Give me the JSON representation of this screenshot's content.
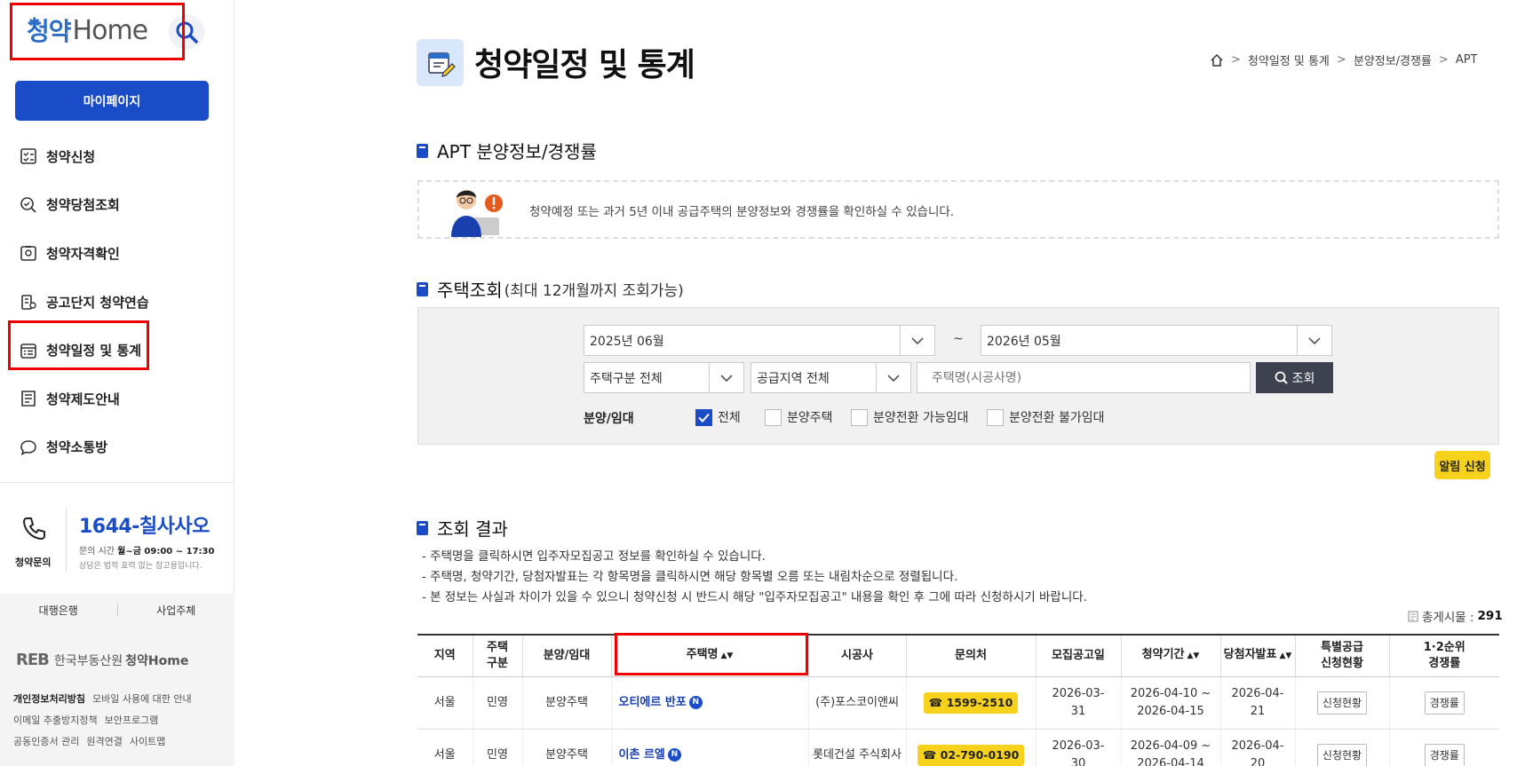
{
  "sidebar": {
    "logo_text_k": "청약",
    "logo_text_home": "Home",
    "mypage_label": "마이페이지",
    "nav": [
      {
        "label": "청약신청"
      },
      {
        "label": "청약당첨조회"
      },
      {
        "label": "청약자격확인"
      },
      {
        "label": "공고단지 청약연습"
      },
      {
        "label": "청약일정 및 통계"
      },
      {
        "label": "청약제도안내"
      },
      {
        "label": "청약소통방"
      }
    ],
    "contact": {
      "label": "청약문의",
      "number": "1644-칠사사오",
      "hours_prefix": "문의 시간 ",
      "hours_value": "월~금 09:00 ~ 17:30",
      "note": "상담은 법적 효력 없는 참고용입니다."
    },
    "tabs": [
      "대행은행",
      "사업주체"
    ],
    "org_mark": "REB",
    "org_name": "한국부동산원",
    "org_service": "청약Home",
    "links": [
      {
        "label": "개인정보처리방침",
        "bold": true
      },
      {
        "label": "모바일 사용에 대한 안내",
        "bold": false
      },
      {
        "label": "이메일 추출방지정책",
        "bold": false
      },
      {
        "label": "보안프로그램",
        "bold": false
      },
      {
        "label": "공동인증서 관리",
        "bold": false
      },
      {
        "label": "원격연결",
        "bold": false
      },
      {
        "label": "사이트맵",
        "bold": false
      }
    ]
  },
  "header": {
    "title": "청약일정 및 통계",
    "breadcrumb": [
      "청약일정 및 통계",
      "분양정보/경쟁률",
      "APT"
    ]
  },
  "section1": {
    "title": "APT 분양정보/경쟁률",
    "notice": "청약예정 또는 과거 5년 이내 공급주택의 분양정보와 경쟁률을 확인하실 수 있습니다."
  },
  "section2": {
    "title": "주택조회",
    "subtitle": "(최대 12개월까지 조회가능)",
    "start_month": "2025년 06월",
    "tilde": "~",
    "end_month": "2026년 05월",
    "type_select": "주택구분 전체",
    "region_select": "공급지역 전체",
    "name_placeholder": "주택명(시공사명)",
    "search_label": "조회",
    "filter_label": "분양/임대",
    "checkboxes": [
      {
        "label": "전체",
        "checked": true
      },
      {
        "label": "분양주택",
        "checked": false
      },
      {
        "label": "분양전환 가능임대",
        "checked": false
      },
      {
        "label": "분양전환 불가임대",
        "checked": false
      }
    ],
    "alarm_label": "알림 신청"
  },
  "section3": {
    "title": "조회 결과",
    "notes": [
      "주택명을 클릭하시면 입주자모집공고 정보를 확인하실 수 있습니다.",
      "주택명, 청약기간, 당첨자발표는 각 항목명을 클릭하시면 해당 항목별 오름 또는 내림차순으로 정렬됩니다.",
      "본 정보는 사실과 차이가 있을 수 있으니 청약신청 시 반드시 해당 \"입주자모집공고\" 내용을 확인 후 그에 따라 신청하시기 바랍니다."
    ],
    "total_label": "총게시물 :",
    "total_value": "291",
    "columns": {
      "region": "지역",
      "type_l1": "주택",
      "type_l2": "구분",
      "sale": "분양/임대",
      "name": "주택명",
      "builder": "시공사",
      "contact": "문의처",
      "notice_date": "모집공고일",
      "period": "청약기간",
      "winner": "당첨자발표",
      "special_l1": "특별공급",
      "special_l2": "신청현황",
      "rate_l1": "1·2순위",
      "rate_l2": "경쟁률",
      "sort_glyph": "▲▼"
    },
    "rows": [
      {
        "region": "서울",
        "type": "민영",
        "sale": "분양주택",
        "name": "오티에르 반포",
        "badge": "N",
        "builder": "(주)포스코이앤씨",
        "phone": "☎ 1599-2510",
        "notice_l1": "2026-03-",
        "notice_l2": "31",
        "period_l1": "2026-04-10 ~",
        "period_l2": "2026-04-15",
        "winner_l1": "2026-04-",
        "winner_l2": "21",
        "special_btn": "신청현황",
        "rate_btn": "경쟁률"
      },
      {
        "region": "서울",
        "type": "민영",
        "sale": "분양주택",
        "name": "이촌 르엘",
        "badge": "N",
        "builder": "롯데건설 주식회사",
        "phone": "☎ 02-790-0190",
        "notice_l1": "2026-03-",
        "notice_l2": "30",
        "period_l1": "2026-04-09 ~",
        "period_l2": "2026-04-14",
        "winner_l1": "2026-04-",
        "winner_l2": "20",
        "special_btn": "신청현황",
        "rate_btn": "경쟁률"
      }
    ]
  }
}
